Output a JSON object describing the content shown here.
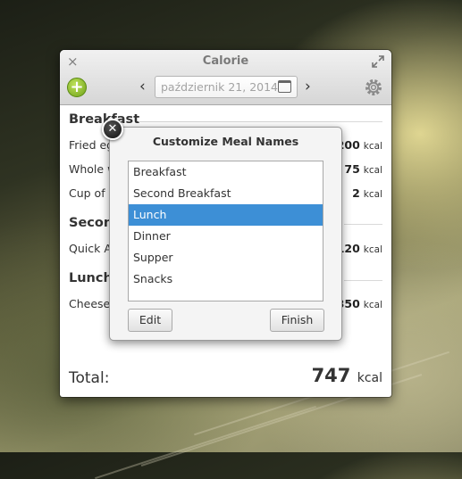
{
  "window": {
    "title": "Calorie",
    "close_glyph": "×",
    "add_glyph": "+",
    "prev_glyph": "‹",
    "next_glyph": "›",
    "date_value": "październik 21, 2014",
    "icons": [
      "close-icon",
      "maximize-icon",
      "add-icon",
      "chevron-left-icon",
      "chevron-right-icon",
      "calendar-icon",
      "gear-icon"
    ]
  },
  "meals": {
    "breakfast": {
      "title": "Breakfast",
      "items": [
        {
          "name": "Fried egg",
          "value": "200",
          "unit": "kcal"
        },
        {
          "name": "Whole w",
          "value": "75",
          "unit": "kcal"
        },
        {
          "name": "Cup of c",
          "value": "2",
          "unit": "kcal"
        }
      ]
    },
    "second": {
      "title": "Second",
      "items": [
        {
          "name": "Quick Ad",
          "value": "120",
          "unit": "kcal"
        }
      ]
    },
    "lunch": {
      "title": "Lunch",
      "items": [
        {
          "name": "Cheeseb",
          "value": "350",
          "unit": "kcal"
        }
      ]
    }
  },
  "total": {
    "label": "Total:",
    "value": "747",
    "unit": "kcal"
  },
  "dialog": {
    "title": "Customize Meal Names",
    "close_glyph": "✕",
    "items": [
      "Breakfast",
      "Second Breakfast",
      "Lunch",
      "Dinner",
      "Supper",
      "Snacks"
    ],
    "selected": "Lunch",
    "edit_label": "Edit",
    "finish_label": "Finish"
  },
  "colors": {
    "selection": "#3d8fd6",
    "add_button": "#7fb223"
  }
}
